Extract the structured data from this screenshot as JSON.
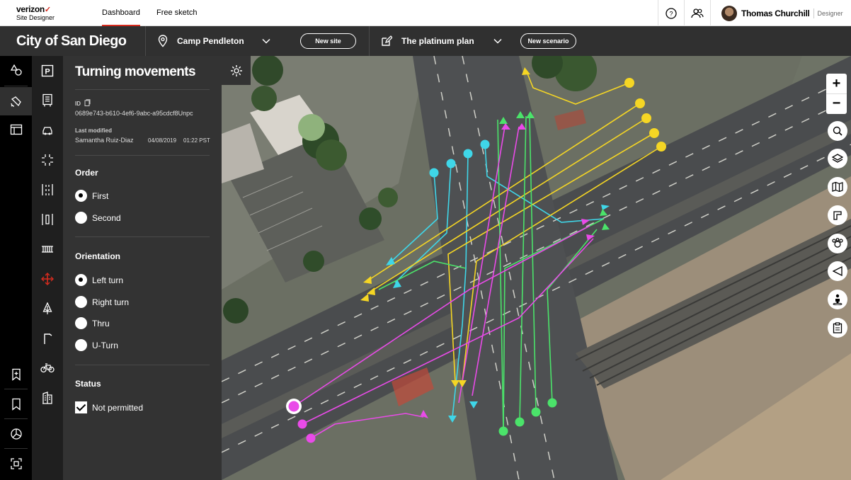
{
  "app": {
    "brand": "verizon",
    "subtitle": "Site Designer"
  },
  "nav": {
    "tabs": [
      {
        "label": "Dashboard",
        "active": true
      },
      {
        "label": "Free sketch",
        "active": false
      }
    ]
  },
  "user": {
    "name": "Thomas Churchill",
    "role": "Designer"
  },
  "context": {
    "city": "City of San Diego",
    "site": "Camp Pendleton",
    "new_site_label": "New site",
    "scenario": "The platinum plan",
    "new_scenario_label": "New scenario"
  },
  "panel": {
    "title": "Turning movements",
    "id_label": "ID",
    "id_value": "0689e743-b610-4ef6-9abc-a95cdcf8Unpc",
    "last_modified_label": "Last modified",
    "last_modified_by": "Samantha Ruiz-Diaz",
    "last_modified_date": "04/08/2019",
    "last_modified_time": "01:22 PST",
    "order": {
      "label": "Order",
      "options": [
        "First",
        "Second"
      ],
      "selected": "First"
    },
    "orientation": {
      "label": "Orientation",
      "options": [
        "Left turn",
        "Right turn",
        "Thru",
        "U-Turn"
      ],
      "selected": "Left turn"
    },
    "status": {
      "label": "Status",
      "checkbox_label": "Not permitted",
      "checked": true
    }
  },
  "colors": {
    "accent": "#d52b1e",
    "cyan": "#3fd6e8",
    "yellow": "#f5d624",
    "green": "#4be36a",
    "magenta": "#e94be8",
    "rail": "#000000",
    "tools": "#1f1f1f",
    "panel": "#333333"
  },
  "icons": {
    "rail": [
      "shapes-icon",
      "satellite-icon",
      "layout-icon",
      "bookmark-add-icon",
      "bookmark-icon",
      "chart-pie-icon",
      "focus-icon"
    ],
    "tools": [
      "parking-icon",
      "signal-cabinet-icon",
      "vehicle-icon",
      "crosswalk-icon",
      "lane-icon",
      "median-icon",
      "barrier-icon",
      "turning-movements-icon",
      "tree-icon",
      "streetlight-icon",
      "bicycle-icon",
      "building-icon"
    ],
    "map": [
      "search-icon",
      "layers-icon",
      "map-icon",
      "draw-icon",
      "group-icon",
      "navigate-icon",
      "street-view-icon",
      "clipboard-icon"
    ]
  }
}
